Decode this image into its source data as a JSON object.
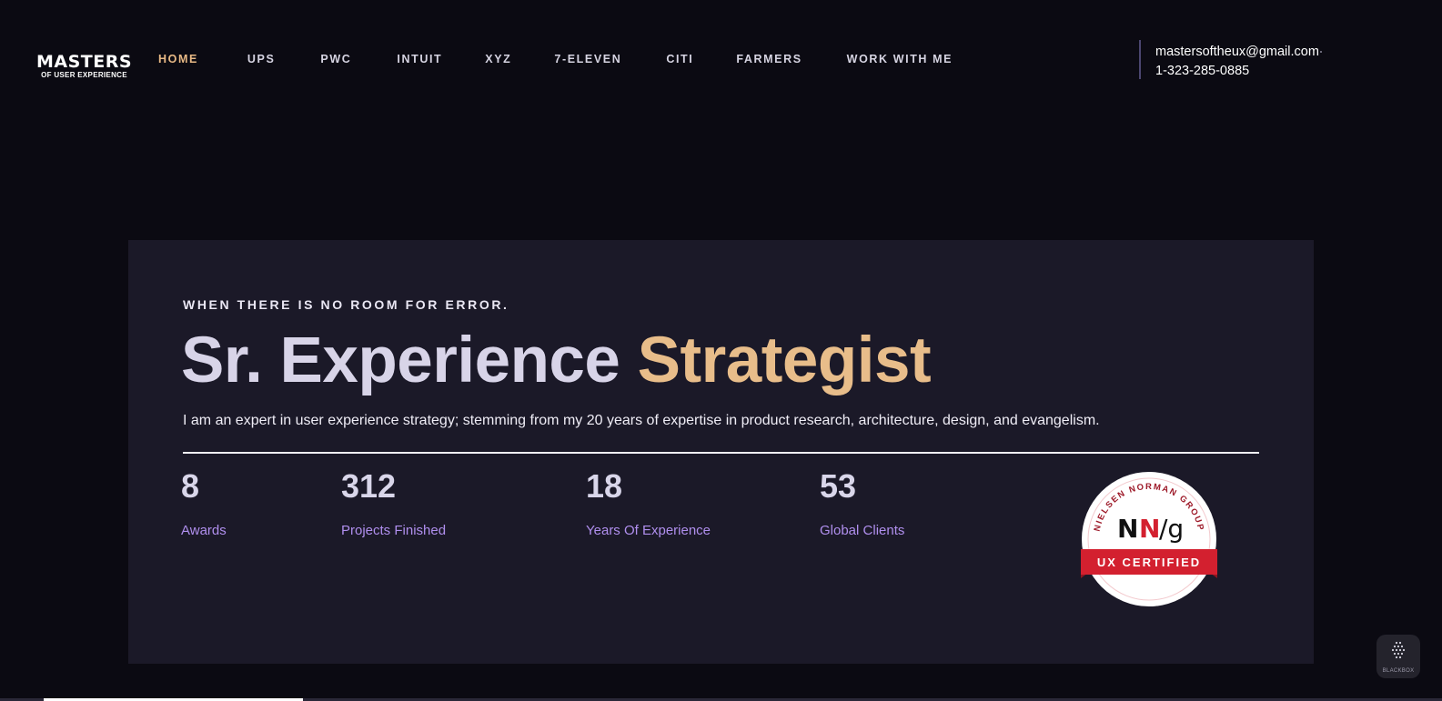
{
  "logo": {
    "main": "MASTERS",
    "sub": "OF USER EXPERIENCE"
  },
  "nav": {
    "items": [
      {
        "label": "HOME",
        "active": true
      },
      {
        "label": "UPS",
        "active": false
      },
      {
        "label": "PWC",
        "active": false
      },
      {
        "label": "INTUIT",
        "active": false
      },
      {
        "label": "XYZ",
        "active": false
      },
      {
        "label": "7-ELEVEN",
        "active": false
      },
      {
        "label": "CITI",
        "active": false
      },
      {
        "label": "FARMERS",
        "active": false
      },
      {
        "label": "WORK WITH ME",
        "active": false
      }
    ]
  },
  "contact": {
    "email": "mastersoftheux@gmail.com",
    "phone": "1-323-285-0885"
  },
  "hero": {
    "eyebrow": "WHEN THERE IS NO ROOM FOR ERROR.",
    "title_main": "Sr. Experience",
    "title_accent": "Strategist",
    "intro": "I am an expert in user experience strategy; stemming from my 20 years of expertise in product research, architecture, design, and evangelism.",
    "stats": [
      {
        "value": "8",
        "label": "Awards"
      },
      {
        "value": "312",
        "label": "Projects Finished"
      },
      {
        "value": "18",
        "label": "Years Of Experience"
      },
      {
        "value": "53",
        "label": "Global Clients"
      }
    ]
  },
  "badge": {
    "arc_text": "NIELSEN NORMAN GROUP",
    "logo_n1": "N",
    "logo_n2": "N",
    "logo_g": "/g",
    "ribbon": "UX CERTIFIED"
  },
  "scroll_progress": 0.18,
  "widget": {
    "label": "BLACKBOX",
    "icon": "blackbox-cube-icon"
  },
  "colors": {
    "background": "#0b0a12",
    "card": "#1b1928",
    "accent_gold": "#e8bd8a",
    "accent_purple": "#b08fee",
    "badge_red": "#d3202f"
  }
}
